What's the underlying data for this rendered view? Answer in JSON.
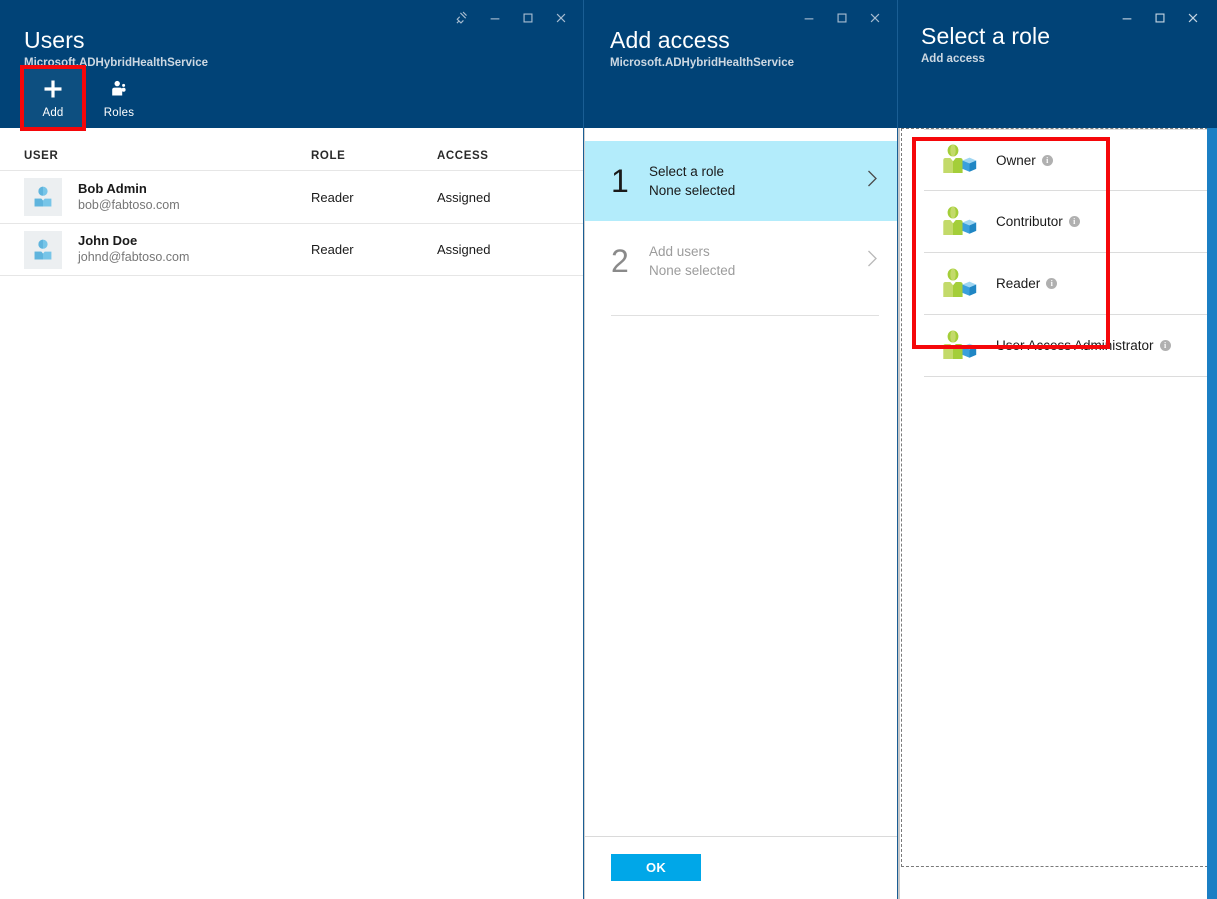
{
  "panels": {
    "users": {
      "title": "Users",
      "subtitle": "Microsoft.ADHybridHealthService",
      "window_controls": [
        "pin-icon",
        "minimize-icon",
        "maximize-icon",
        "close-icon"
      ],
      "toolbar": [
        {
          "label": "Add",
          "icon": "plus-icon",
          "active": true
        },
        {
          "label": "Roles",
          "icon": "people-icon",
          "active": false
        }
      ],
      "table": {
        "columns": [
          "USER",
          "ROLE",
          "ACCESS"
        ],
        "rows": [
          {
            "name": "Bob Admin",
            "email": "bob@fabtoso.com",
            "role": "Reader",
            "access": "Assigned",
            "avatar": "user-avatar-icon"
          },
          {
            "name": "John Doe",
            "email": "johnd@fabtoso.com",
            "role": "Reader",
            "access": "Assigned",
            "avatar": "user-avatar-icon"
          }
        ]
      }
    },
    "add_access": {
      "title": "Add access",
      "subtitle": "Microsoft.ADHybridHealthService",
      "window_controls": [
        "minimize-icon",
        "maximize-icon",
        "close-icon"
      ],
      "steps": [
        {
          "number": "1",
          "title": "Select a role",
          "sub": "None selected",
          "state": "active"
        },
        {
          "number": "2",
          "title": "Add users",
          "sub": "None selected",
          "state": "inactive"
        }
      ],
      "ok_label": "OK"
    },
    "select_role": {
      "title": "Select a role",
      "subtitle": "Add access",
      "window_controls": [
        "minimize-icon",
        "maximize-icon",
        "close-icon"
      ],
      "roles": [
        {
          "label": "Owner",
          "icon": "role-user-cube-icon",
          "info": "i"
        },
        {
          "label": "Contributor",
          "icon": "role-user-cube-icon",
          "info": "i"
        },
        {
          "label": "Reader",
          "icon": "role-user-cube-icon",
          "info": "i"
        },
        {
          "label": "User Access Administrator",
          "icon": "role-user-cube-icon",
          "info": "i"
        }
      ]
    }
  },
  "annotations": [
    {
      "name": "add-button-highlight",
      "color": "#f5070a"
    },
    {
      "name": "roles-list-highlight",
      "color": "#f5070a"
    }
  ],
  "colors": {
    "blade_header": "#014377",
    "accent_button": "#00a7e8",
    "step_active": "#b3ecfb",
    "highlight": "#f5070a",
    "rail_blue": "#1b7fc4"
  }
}
